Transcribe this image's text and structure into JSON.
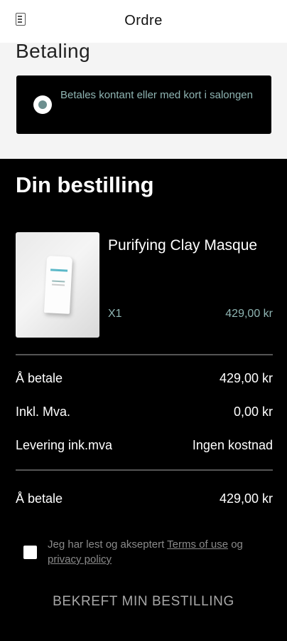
{
  "header": {
    "title": "Ordre",
    "icon": "document-icon"
  },
  "payment": {
    "heading": "Betaling",
    "option_label": "Betales kontant eller med kort i salongen",
    "selected": true,
    "accent_color": "#8fb5b3"
  },
  "order": {
    "heading": "Din bestilling",
    "items": [
      {
        "name": "Purifying Clay Masque",
        "quantity": "X1",
        "price": "429,00 kr"
      }
    ]
  },
  "summary": {
    "rows": [
      {
        "label": "Å betale",
        "value": "429,00 kr"
      },
      {
        "label": "Inkl. Mva.",
        "value": "0,00 kr"
      },
      {
        "label": "Levering ink.mva",
        "value": "Ingen kostnad"
      }
    ],
    "total": {
      "label": "Å betale",
      "value": "429,00 kr"
    }
  },
  "terms": {
    "text_prefix": "Jeg har lest og akseptert ",
    "terms_link": "Terms of use",
    "text_middle": " og ",
    "privacy_link": "privacy policy",
    "checked": false
  },
  "confirm_button": "BEKREFT MIN BESTILLING"
}
